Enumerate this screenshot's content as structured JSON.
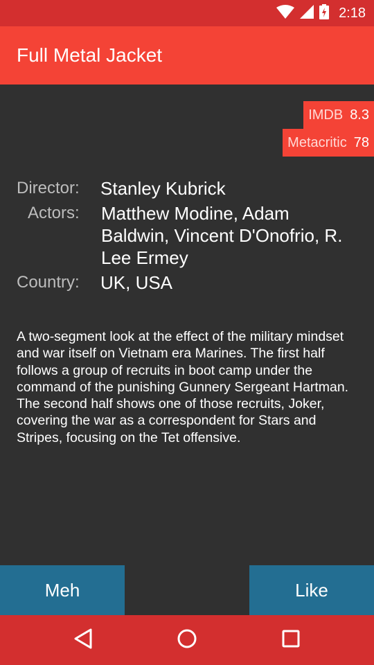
{
  "status_bar": {
    "time": "2:18",
    "icons": [
      "wifi-icon",
      "cell-signal-icon",
      "battery-charging-icon"
    ]
  },
  "app_bar": {
    "title": "Full Metal Jacket"
  },
  "ratings": {
    "imdb_label": "IMDB",
    "imdb_value": "8.3",
    "metacritic_label": "Metacritic",
    "metacritic_value": "78"
  },
  "details": {
    "director_label": "Director:",
    "director_value": "Stanley Kubrick",
    "actors_label": "Actors:",
    "actors_value": "Matthew Modine, Adam Baldwin, Vincent D'Onofrio, R. Lee Ermey",
    "country_label": "Country:",
    "country_value": "UK, USA"
  },
  "plot": "A two-segment look at the effect of the military mindset and war itself on Vietnam era Marines. The first half follows a group of recruits in boot camp under the command of the punishing Gunnery Sergeant Hartman. The second half shows one of those recruits, Joker, covering the war as a correspondent for Stars and Stripes, focusing on the Tet offensive.",
  "actions": {
    "meh_label": "Meh",
    "like_label": "Like"
  },
  "nav_bar": {
    "icons": [
      "back-icon",
      "home-icon",
      "recents-icon"
    ]
  },
  "colors": {
    "status_bar": "#d32f2f",
    "app_bar": "#f44336",
    "background": "#303030",
    "button": "#236e92",
    "nav_bar": "#d32f2f"
  }
}
